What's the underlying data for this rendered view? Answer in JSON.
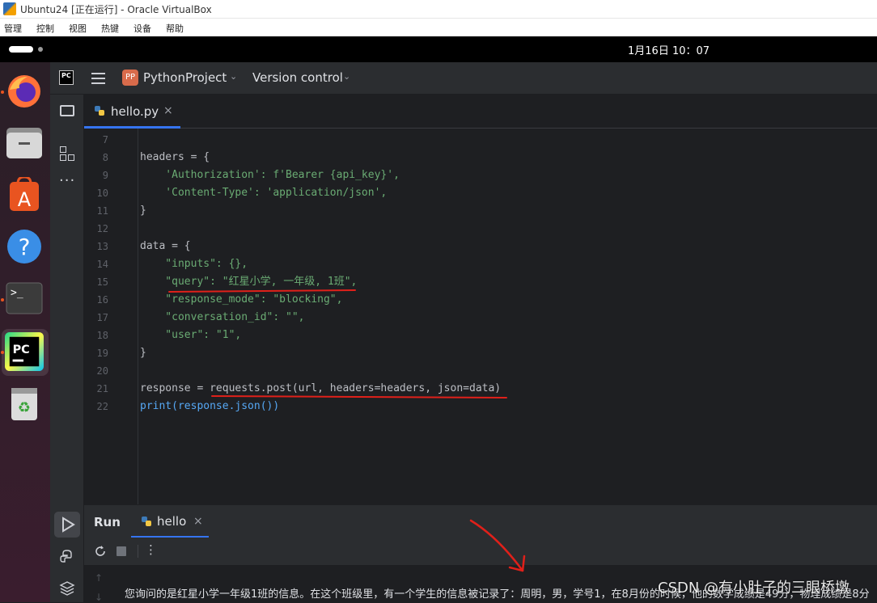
{
  "vbox": {
    "title": "Ubuntu24 [正在运行] - Oracle VirtualBox",
    "menu": [
      "管理",
      "控制",
      "视图",
      "热键",
      "设备",
      "帮助"
    ]
  },
  "ubuntu": {
    "clock": "1月16日  10：07",
    "dock": [
      {
        "name": "firefox-icon"
      },
      {
        "name": "files-icon"
      },
      {
        "name": "app-center-icon"
      },
      {
        "name": "help-icon"
      },
      {
        "name": "terminal-icon"
      },
      {
        "name": "pycharm-icon"
      },
      {
        "name": "trash-icon"
      }
    ]
  },
  "ide": {
    "logo_text": "PC",
    "project_badge": "PP",
    "project_name": "PythonProject",
    "vcs_label": "Version control",
    "file_tab": "hello.py",
    "close_glyph": "×",
    "code_lines": [
      {
        "n": "7",
        "text": ""
      },
      {
        "n": "8",
        "text": "headers = {"
      },
      {
        "n": "9",
        "text": "    'Authorization': f'Bearer {api_key}',"
      },
      {
        "n": "10",
        "text": "    'Content-Type': 'application/json',"
      },
      {
        "n": "11",
        "text": "}"
      },
      {
        "n": "12",
        "text": ""
      },
      {
        "n": "13",
        "text": "data = {"
      },
      {
        "n": "14",
        "text": "    \"inputs\": {},"
      },
      {
        "n": "15",
        "text": "    \"query\": \"红星小学, 一年级, 1班\","
      },
      {
        "n": "16",
        "text": "    \"response_mode\": \"blocking\","
      },
      {
        "n": "17",
        "text": "    \"conversation_id\": \"\","
      },
      {
        "n": "18",
        "text": "    \"user\": \"1\","
      },
      {
        "n": "19",
        "text": "}"
      },
      {
        "n": "20",
        "text": ""
      },
      {
        "n": "21",
        "text": "response = requests.post(url, headers=headers, json=data)"
      },
      {
        "n": "22",
        "text": "print(response.json())"
      }
    ],
    "run": {
      "label": "Run",
      "tab": "hello",
      "output": "您询问的是红星小学一年级1班的信息。在这个班级里，有一个学生的信息被记录了：周明，男，学号1，在8月份的时候，他的数学成绩是49分，物理成绩是8分，"
    }
  },
  "watermark": "CSDN @有小肚子的三眼桥墩",
  "colors": {
    "annotation": "#e0201a",
    "string": "#6aab73",
    "keyword": "#c77dbb",
    "param": "#e08855"
  }
}
